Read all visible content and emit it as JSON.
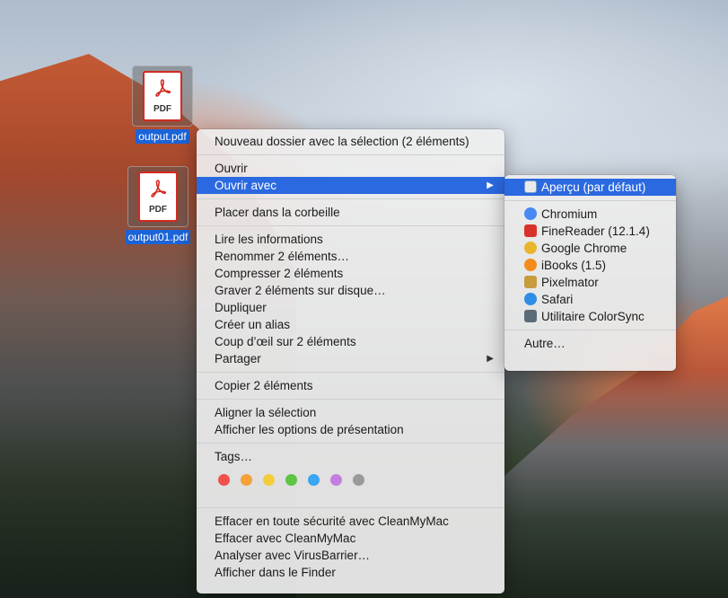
{
  "desktop": {
    "files": [
      {
        "name": "output.pdf",
        "icon": "pdf-file-icon",
        "badge": "PDF"
      },
      {
        "name": "output01.pdf",
        "icon": "pdf-file-icon",
        "badge": "PDF"
      }
    ]
  },
  "context_menu": {
    "new_folder": "Nouveau dossier avec la sélection (2 éléments)",
    "open": "Ouvrir",
    "open_with": "Ouvrir avec",
    "move_to_trash": "Placer dans la corbeille",
    "get_info": "Lire les informations",
    "rename": "Renommer 2 éléments…",
    "compress": "Compresser 2 éléments",
    "burn": "Graver 2 éléments sur disque…",
    "duplicate": "Dupliquer",
    "make_alias": "Créer un alias",
    "quick_look": "Coup d’œil sur 2 éléments",
    "share": "Partager",
    "copy": "Copier 2 éléments",
    "align": "Aligner la sélection",
    "view_options": "Afficher les options de présentation",
    "tags": "Tags…",
    "tag_colors": [
      "#f0514c",
      "#f6a03a",
      "#f5cd3b",
      "#5dc444",
      "#3aa5f2",
      "#c47ee0",
      "#9a9a9a"
    ],
    "cleanmymac_secure": "Effacer en toute sécurité avec CleanMyMac",
    "cleanmymac_erase": "Effacer avec CleanMyMac",
    "virusbarrier": "Analyser avec VirusBarrier…",
    "show_in_finder": "Afficher dans le Finder"
  },
  "open_with_submenu": {
    "default_app": "Aperçu (par défaut)",
    "apps": [
      {
        "label": "Chromium",
        "icon": "chromium-icon",
        "color": "#4a89f3"
      },
      {
        "label": "FineReader (12.1.4)",
        "icon": "finereader-icon",
        "color": "#d8332a"
      },
      {
        "label": "Google Chrome",
        "icon": "chrome-icon",
        "color": "#e9b52f"
      },
      {
        "label": "iBooks (1.5)",
        "icon": "ibooks-icon",
        "color": "#f28c1b"
      },
      {
        "label": "Pixelmator",
        "icon": "pixelmator-icon",
        "color": "#c89b3c"
      },
      {
        "label": "Safari",
        "icon": "safari-icon",
        "color": "#2f8de4"
      },
      {
        "label": "Utilitaire ColorSync",
        "icon": "colorsync-icon",
        "color": "#5c6b7a"
      }
    ],
    "other": "Autre…"
  }
}
